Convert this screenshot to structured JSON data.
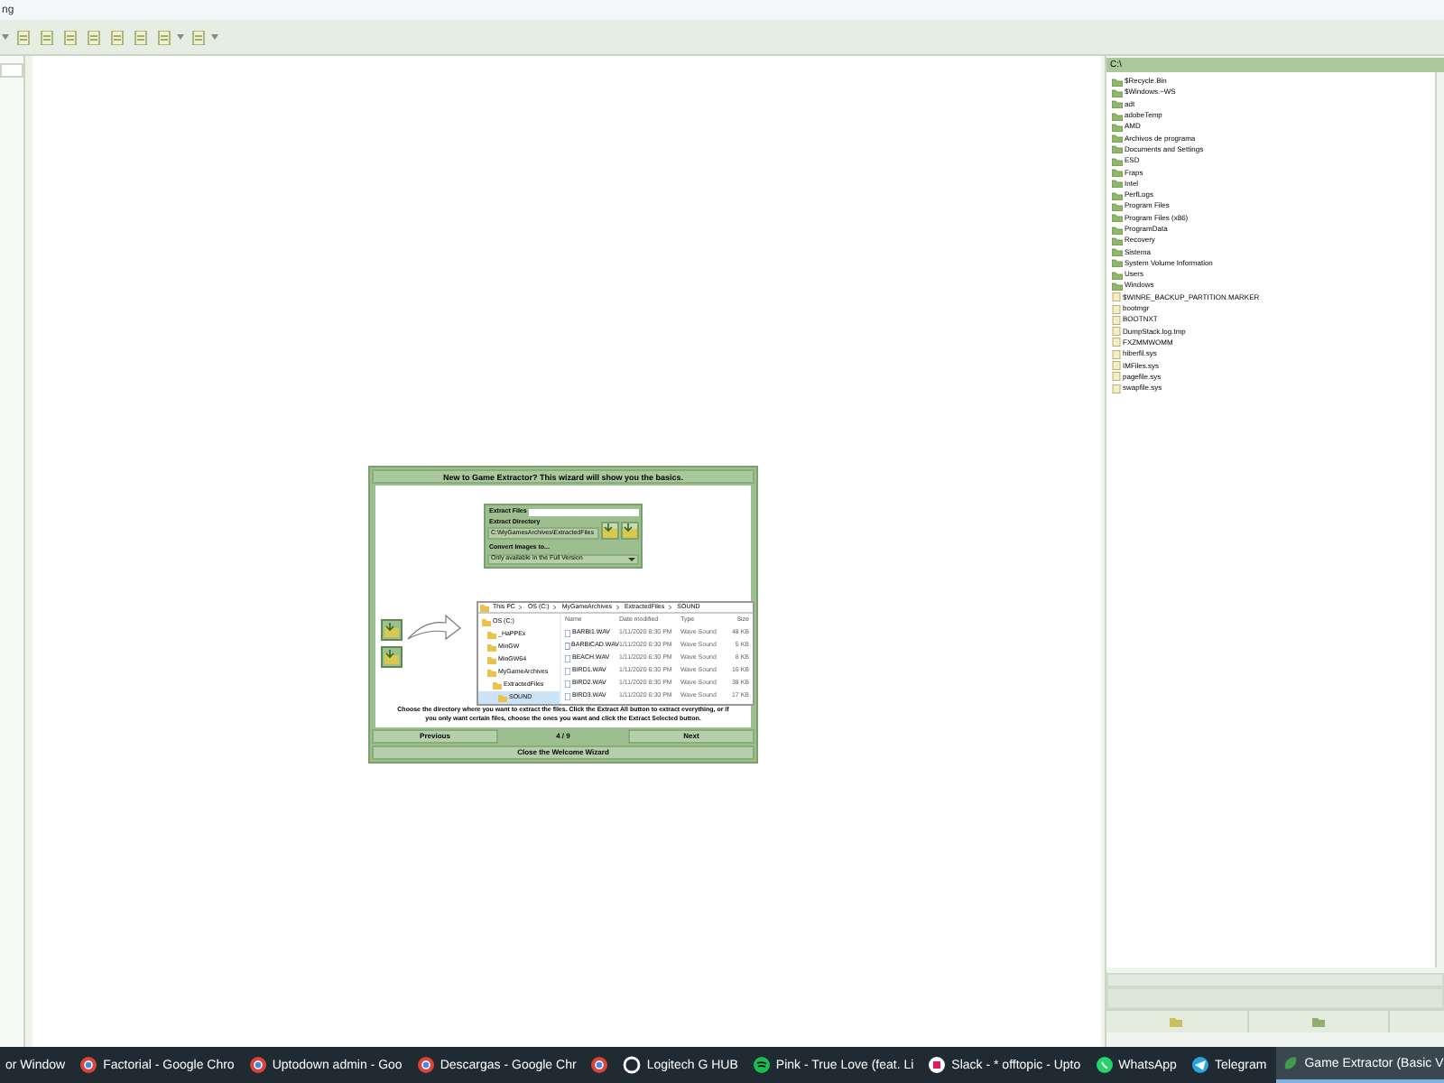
{
  "window": {
    "title": "ng"
  },
  "toolbar": {
    "buttons": [
      {
        "kind": "dropdown"
      },
      {
        "kind": "tool"
      },
      {
        "kind": "tool"
      },
      {
        "kind": "tool"
      },
      {
        "kind": "tool"
      },
      {
        "kind": "tool"
      },
      {
        "kind": "tool"
      },
      {
        "kind": "tool"
      },
      {
        "kind": "dropdown"
      },
      {
        "kind": "tool"
      },
      {
        "kind": "dropdown"
      }
    ]
  },
  "wizard": {
    "title": "New to Game Extractor? This wizard will show you the basics.",
    "extract_panel": {
      "title": "Extract Files",
      "directory_label": "Extract Directory",
      "directory_value": "C:\\MyGamesArchives\\ExtractedFiles",
      "convert_label": "Convert Images to...",
      "convert_value": "Only available in the Full Version"
    },
    "explorer": {
      "breadcrumb": [
        "This PC",
        "OS (C:)",
        "MyGameArchives",
        "ExtractedFiles",
        "SOUND"
      ],
      "tree": [
        {
          "label": "OS (C:)",
          "selected": false,
          "children": [
            {
              "label": "_HaPPEx",
              "selected": false
            },
            {
              "label": "MinGW",
              "selected": false
            },
            {
              "label": "MinGW64",
              "selected": false
            },
            {
              "label": "MyGameArchives",
              "selected": false,
              "children": [
                {
                  "label": "ExtractedFiles",
                  "selected": false,
                  "children": [
                    {
                      "label": "SOUND",
                      "selected": true
                    }
                  ]
                }
              ]
            }
          ]
        }
      ],
      "columns": [
        "Name",
        "Date modified",
        "Type",
        "Size"
      ],
      "rows": [
        [
          "BARBI1.WAV",
          "1/11/2020 6:30 PM",
          "Wave Sound",
          "48 KB"
        ],
        [
          "BARBICAD.WAV",
          "1/11/2020 6:30 PM",
          "Wave Sound",
          "5 KB"
        ],
        [
          "BEACH.WAV",
          "1/11/2020 6:30 PM",
          "Wave Sound",
          "8 KB"
        ],
        [
          "BIRD1.WAV",
          "1/11/2020 6:30 PM",
          "Wave Sound",
          "16 KB"
        ],
        [
          "BIRD2.WAV",
          "1/11/2020 6:30 PM",
          "Wave Sound",
          "38 KB"
        ],
        [
          "BIRD3.WAV",
          "1/11/2020 6:30 PM",
          "Wave Sound",
          "17 KB"
        ]
      ]
    },
    "description": "Choose the directory where you want to extract the files. Click the Extract All button to extract everything, or if you only want certain files, choose the ones you want and click the Extract Selected button.",
    "previous": "Previous",
    "page": "4 / 9",
    "next": "Next",
    "close": "Close the Welcome Wizard"
  },
  "file_panel": {
    "path": "C:\\",
    "items": [
      {
        "name": "$Recycle.Bin",
        "kind": "folder"
      },
      {
        "name": "$Windows.~WS",
        "kind": "folder"
      },
      {
        "name": "adt",
        "kind": "folder"
      },
      {
        "name": "adobeTemp",
        "kind": "folder"
      },
      {
        "name": "AMD",
        "kind": "folder"
      },
      {
        "name": "Archivos de programa",
        "kind": "folder"
      },
      {
        "name": "Documents and Settings",
        "kind": "folder"
      },
      {
        "name": "ESD",
        "kind": "folder"
      },
      {
        "name": "Fraps",
        "kind": "folder"
      },
      {
        "name": "Intel",
        "kind": "folder"
      },
      {
        "name": "PerfLogs",
        "kind": "folder"
      },
      {
        "name": "Program Files",
        "kind": "folder"
      },
      {
        "name": "Program Files (x86)",
        "kind": "folder"
      },
      {
        "name": "ProgramData",
        "kind": "folder"
      },
      {
        "name": "Recovery",
        "kind": "folder"
      },
      {
        "name": "Sistema",
        "kind": "folder"
      },
      {
        "name": "System Volume Information",
        "kind": "folder"
      },
      {
        "name": "Users",
        "kind": "folder"
      },
      {
        "name": "Windows",
        "kind": "folder"
      },
      {
        "name": "$WINRE_BACKUP_PARTITION.MARKER",
        "kind": "file"
      },
      {
        "name": "bootmgr",
        "kind": "file"
      },
      {
        "name": "BOOTNXT",
        "kind": "file"
      },
      {
        "name": "DumpStack.log.tmp",
        "kind": "file"
      },
      {
        "name": "FXZMMWOMM",
        "kind": "file"
      },
      {
        "name": "hiberfil.sys",
        "kind": "file"
      },
      {
        "name": "IMFiles.sys",
        "kind": "file"
      },
      {
        "name": "pagefile.sys",
        "kind": "file"
      },
      {
        "name": "swapfile.sys",
        "kind": "file"
      }
    ]
  },
  "taskbar": {
    "items": [
      {
        "label": "or Window",
        "selected": false
      },
      {
        "label": "Factorial - Google Chro",
        "kind": "browser",
        "selected": false
      },
      {
        "label": "Uptodown admin - Goo",
        "kind": "browser",
        "selected": false
      },
      {
        "label": "Descargas - Google Chr",
        "kind": "browser",
        "selected": false
      },
      {
        "kind": "browser",
        "selected": false
      },
      {
        "label": "Logitech G HUB",
        "kind": "ring",
        "selected": false
      },
      {
        "label": "Pink - True Love (feat. Li",
        "kind": "music",
        "selected": false
      },
      {
        "label": "Slack - * offtopic - Upto",
        "kind": "chat",
        "selected": false
      },
      {
        "label": "WhatsApp",
        "kind": "phone",
        "selected": false
      },
      {
        "label": "Telegram",
        "kind": "plane",
        "selected": false
      },
      {
        "label": "Game Extractor (Basic V",
        "kind": "leaf",
        "selected": true
      }
    ]
  }
}
